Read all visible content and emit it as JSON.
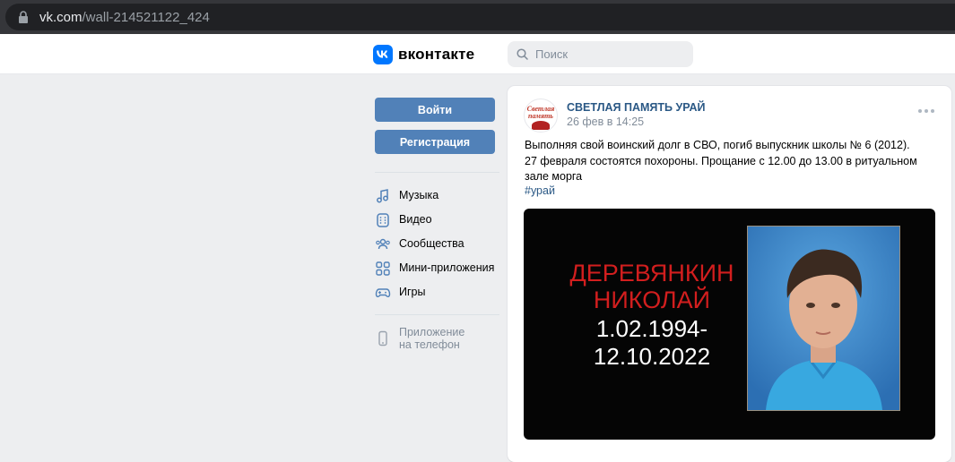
{
  "browser": {
    "url_host": "vk.com",
    "url_path": "/wall-214521122_424"
  },
  "header": {
    "brand": "вконтакте",
    "search_placeholder": "Поиск"
  },
  "sidebar": {
    "login_label": "Войти",
    "register_label": "Регистрация",
    "items": [
      {
        "label": "Музыка",
        "icon": "music-icon"
      },
      {
        "label": "Видео",
        "icon": "video-icon"
      },
      {
        "label": "Сообщества",
        "icon": "communities-icon"
      },
      {
        "label": "Мини-приложения",
        "icon": "mini-apps-icon"
      },
      {
        "label": "Игры",
        "icon": "gamepad-icon"
      }
    ],
    "app_line1": "Приложение",
    "app_line2": "на телефон"
  },
  "post": {
    "avatar_text_line1": "Светлая",
    "avatar_text_line2": "память",
    "author": "СВЕТЛАЯ ПАМЯТЬ УРАЙ",
    "date": "26 фев в 14:25",
    "text": "Выполняя свой воинский долг в СВО, погиб выпускник школы № 6 (2012). 27 февраля состоятся похороны. Прощание с 12.00 до 13.00 в ритуальном зале морга",
    "hashtag": "#урай",
    "image": {
      "surname": "ДЕРЕВЯНКИН",
      "name": "НИКОЛАЙ",
      "date_from": "1.02.1994-",
      "date_to": "12.10.2022"
    }
  },
  "colors": {
    "vk_blue": "#0077ff",
    "button_blue": "#5181b8",
    "link_blue": "#2a5885",
    "memorial_red": "#d21e1e"
  }
}
